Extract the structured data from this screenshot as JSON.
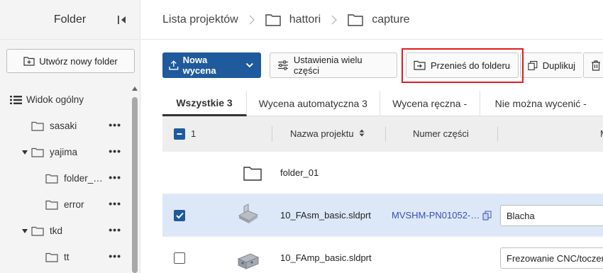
{
  "sidebar": {
    "title": "Folder",
    "new_folder_label": "Utwórz nowy folder",
    "overview_label": "Widok ogólny",
    "items": [
      {
        "label": "sasaki",
        "level": 1,
        "expanded": false
      },
      {
        "label": "yajima",
        "level": 1,
        "expanded": true
      },
      {
        "label": "folder_…",
        "level": 2,
        "expanded": false
      },
      {
        "label": "error",
        "level": 2,
        "expanded": false
      },
      {
        "label": "tkd",
        "level": 1,
        "expanded": true
      },
      {
        "label": "tt",
        "level": 2,
        "expanded": false
      }
    ],
    "more_glyph": "•••"
  },
  "breadcrumb": {
    "root": "Lista projektów",
    "items": [
      "hattori",
      "capture"
    ]
  },
  "toolbar": {
    "new_quote": "Nowa wycena",
    "multi_part_settings": "Ustawienia wielu części",
    "move_to_folder": "Przenieś do folderu",
    "duplicate": "Duplikuj"
  },
  "tabs": [
    {
      "label": "Wszystkie 3",
      "active": true
    },
    {
      "label": "Wycena automatyczna 3",
      "active": false
    },
    {
      "label": "Wycena ręczna -",
      "active": false
    },
    {
      "label": "Nie można wycenić -",
      "active": false
    }
  ],
  "table": {
    "selected_count": "1",
    "columns": [
      "Nazwa projektu",
      "Numer części",
      "M"
    ],
    "rows": [
      {
        "type": "folder",
        "name": "folder_01",
        "part_number": "",
        "process": "",
        "selected": false
      },
      {
        "type": "part",
        "name": "10_FAsm_basic.sldprt",
        "part_number": "MVSHM-PN01052-…",
        "process": "Blacha",
        "selected": true
      },
      {
        "type": "part",
        "name": "10_FAmp_basic.sldprt",
        "part_number": "",
        "process": "Frezowanie CNC/toczer",
        "selected": false
      }
    ]
  },
  "colors": {
    "primary": "#1f5a9c",
    "highlight": "#e21c1c",
    "selected_row": "#dce8f8",
    "link": "#3a4fb5"
  }
}
